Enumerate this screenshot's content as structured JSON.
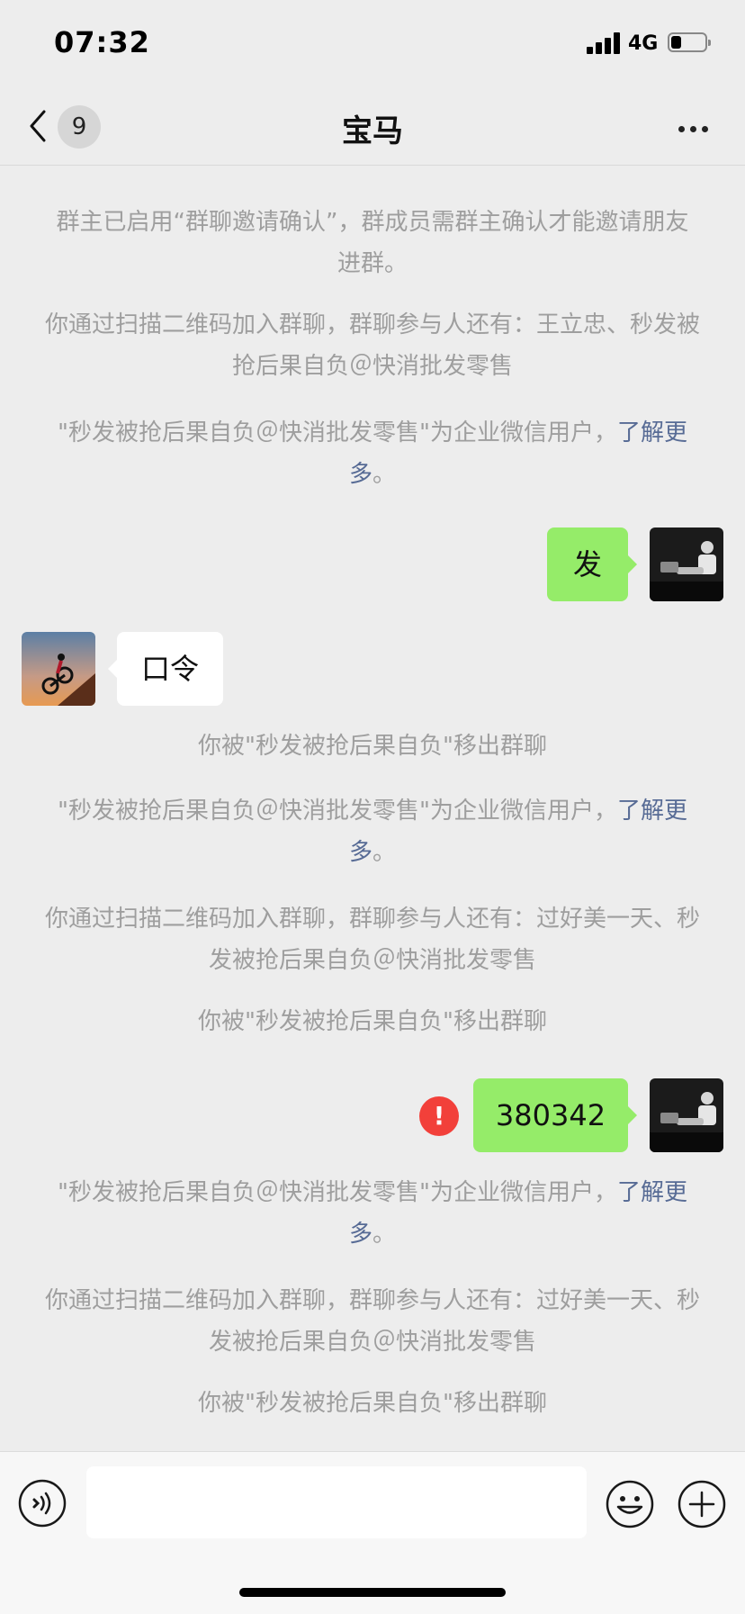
{
  "status_bar": {
    "time": "07:32",
    "network": "4G",
    "battery_level": 0.3
  },
  "nav": {
    "back_badge": "9",
    "title": "宝马"
  },
  "chat": {
    "system_1": "群主已启用“群聊邀请确认”，群成员需群主确认才能邀请朋友进群。",
    "system_2": "你通过扫描二维码加入群聊，群聊参与人还有：王立忠、秒发被抢后果自负＠快消批发零售",
    "system_3_text": "\"秒发被抢后果自负＠快消批发零售\"为企业微信用户，",
    "system_3_link": "了解更多",
    "system_3_end": "。",
    "msg_me_1": "发",
    "msg_them_1": "口令",
    "system_4": "你被\"秒发被抢后果自负\"移出群聊",
    "system_5_text": "\"秒发被抢后果自负＠快消批发零售\"为企业微信用户，",
    "system_5_link": "了解更多",
    "system_5_end": "。",
    "system_6": "你通过扫描二维码加入群聊，群聊参与人还有：过好美一天、秒发被抢后果自负＠快消批发零售",
    "system_7": "你被\"秒发被抢后果自负\"移出群聊",
    "msg_me_2": "380342",
    "error_mark": "!",
    "system_8_text": "\"秒发被抢后果自负＠快消批发零售\"为企业微信用户，",
    "system_8_link": "了解更多",
    "system_8_end": "。",
    "system_9": "你通过扫描二维码加入群聊，群聊参与人还有：过好美一天、秒发被抢后果自负＠快消批发零售",
    "system_10": "你被\"秒发被抢后果自负\"移出群聊"
  },
  "icons": {
    "back": "chevron-left-icon",
    "more": "more-dots-icon",
    "voice": "voice-icon",
    "emoji": "emoji-icon",
    "plus": "plus-icon",
    "error": "error-icon"
  },
  "colors": {
    "my_bubble": "#95ec69",
    "their_bubble": "#ffffff",
    "link": "#576b95",
    "system_text": "#9e9e9e",
    "error": "#f2403a",
    "background": "#ededed"
  }
}
